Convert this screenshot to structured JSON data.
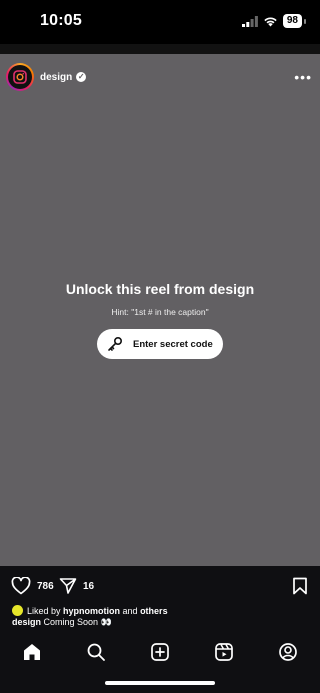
{
  "status_bar": {
    "time": "10:05",
    "battery": "98"
  },
  "post": {
    "username": "design",
    "lock_title": "Unlock this reel from design",
    "hint": "Hint: \"1st # in the caption\"",
    "unlock_button": "Enter secret code"
  },
  "actions": {
    "likes": "786",
    "shares": "16"
  },
  "caption": {
    "liked_by_prefix": "Liked by ",
    "liked_by_user": "hypnomotion",
    "liked_by_mid": " and ",
    "liked_by_others": "others",
    "author": "design",
    "text": " Coming Soon 👀"
  },
  "nav": [
    "home",
    "search",
    "create",
    "reels",
    "profile"
  ],
  "colors": {
    "reel_bg": "#626063",
    "bar_bg": "#0f0f12",
    "accent": "#ffffff"
  }
}
